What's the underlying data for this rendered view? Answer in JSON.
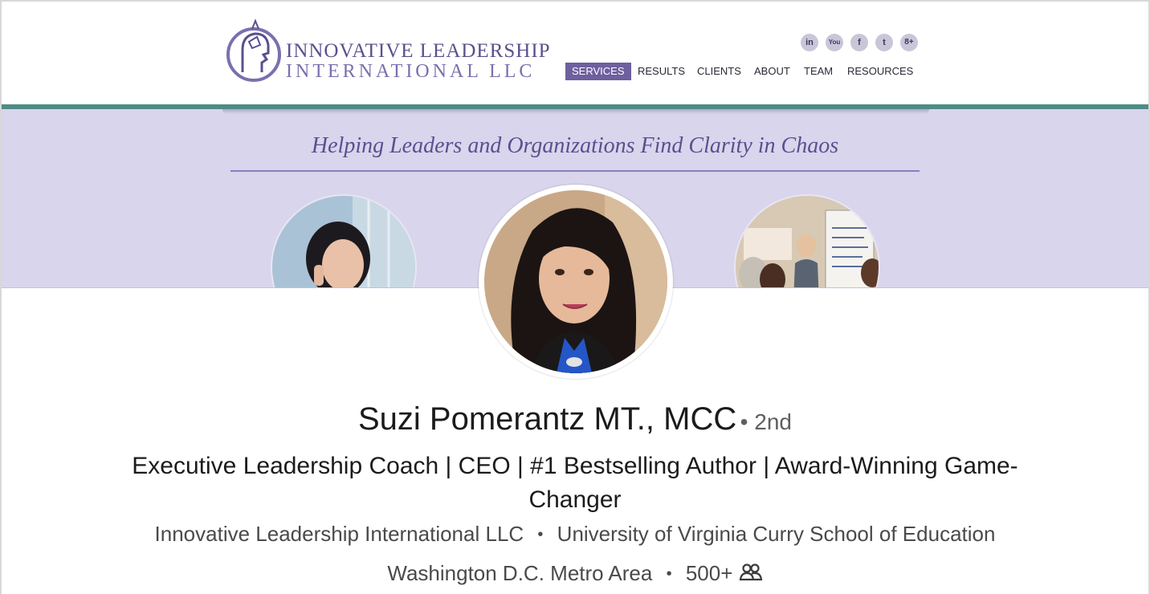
{
  "banner": {
    "logo": {
      "line1": "INNOVATIVE LEADERSHIP",
      "line2": "INTERNATIONAL LLC",
      "accent_color": "#5b4f8f"
    },
    "social_icons": [
      "linkedin-icon",
      "youtube-icon",
      "facebook-icon",
      "twitter-icon",
      "google-plus-icon"
    ],
    "social_labels": [
      "in",
      "You",
      "f",
      "t",
      "8+"
    ],
    "nav": [
      {
        "label": "SERVICES",
        "active": true
      },
      {
        "label": "RESULTS",
        "active": false
      },
      {
        "label": "CLIENTS",
        "active": false
      },
      {
        "label": "ABOUT",
        "active": false
      },
      {
        "label": "TEAM",
        "active": false
      },
      {
        "label": "RESOURCES",
        "active": false
      }
    ],
    "tagline": "Helping Leaders and Organizations Find Clarity in Chaos",
    "colors": {
      "teal": "#4f8c86",
      "lavender": "#d9d5ec",
      "nav_active": "#6e5f9f"
    }
  },
  "profile": {
    "name": "Suzi Pomerantz MT., MCC",
    "degree": "• 2nd",
    "headline": "Executive Leadership Coach | CEO | #1 Bestselling Author | Award-Winning Game-Changer",
    "company": "Innovative Leadership International LLC",
    "separator": "•",
    "education": "University of Virginia Curry School of Education",
    "location": "Washington D.C. Metro Area",
    "connections": "500+",
    "connections_icon": "people-icon"
  }
}
